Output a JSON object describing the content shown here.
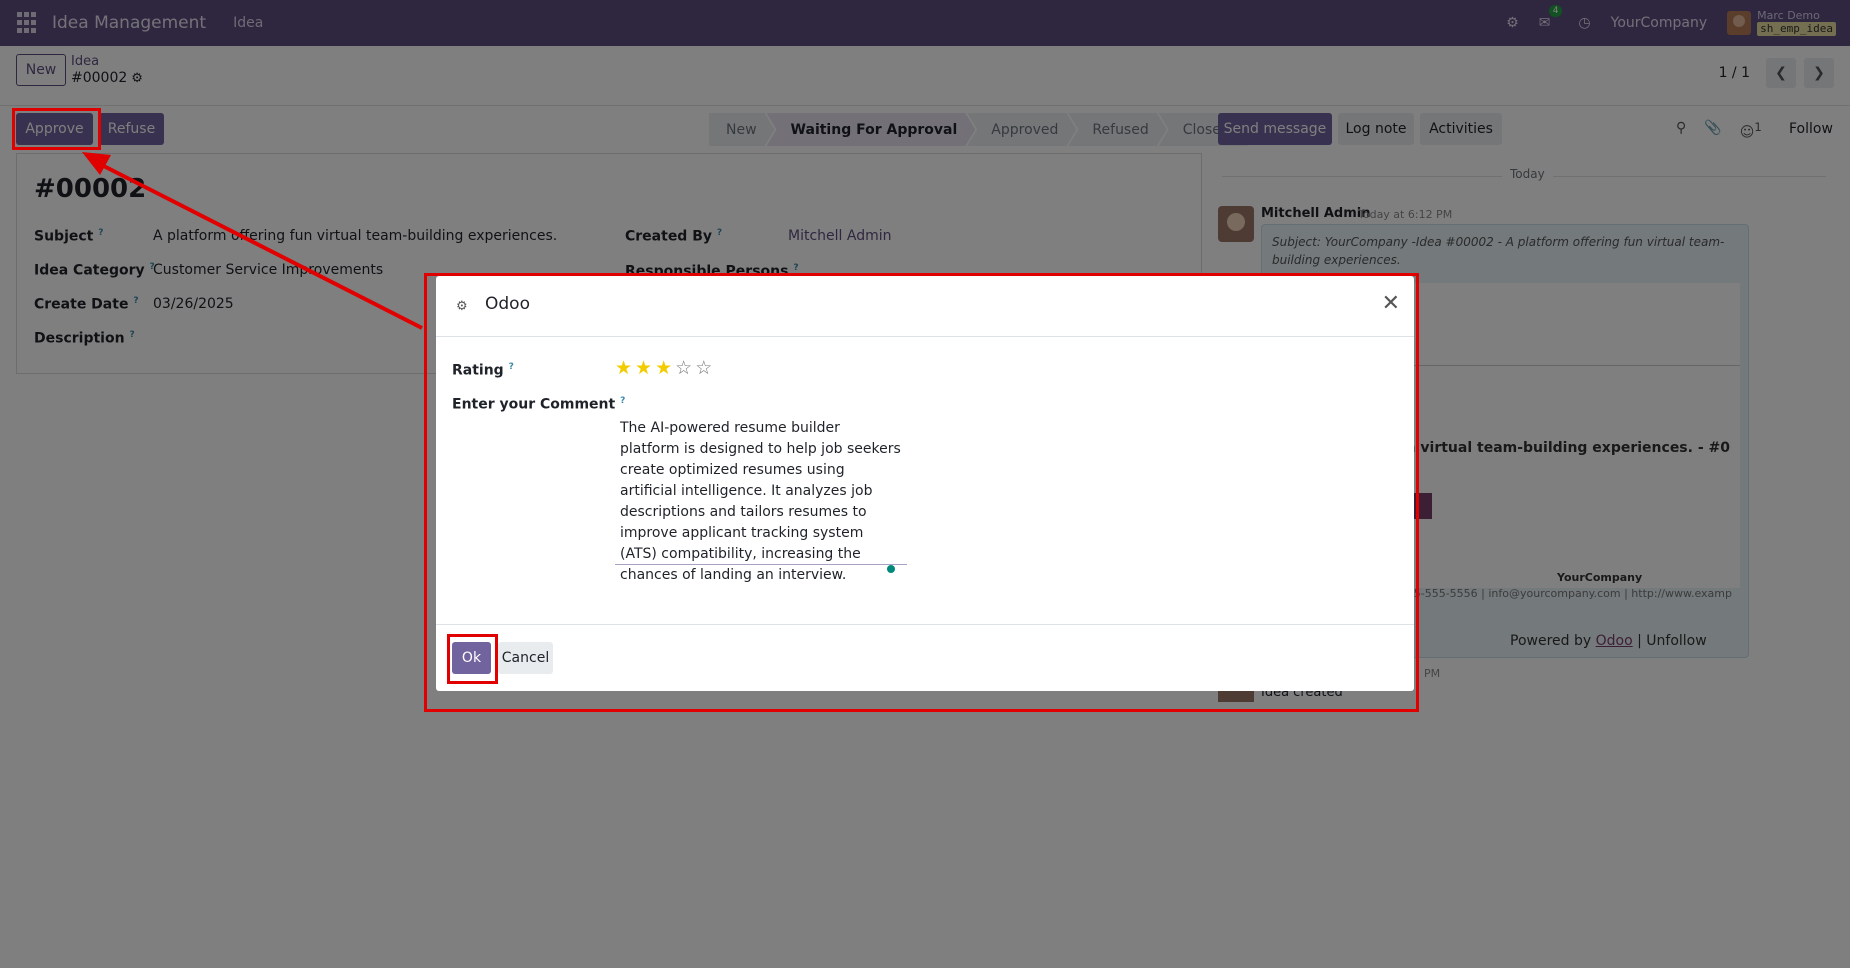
{
  "navbar": {
    "app_name": "Idea Management",
    "menu_item": "Idea",
    "chat_badge": "4",
    "company": "YourCompany",
    "user_name": "Marc Demo",
    "db_name": "sh_emp_idea"
  },
  "control": {
    "new_label": "New",
    "breadcrumb_parent": "Idea",
    "breadcrumb_current": "#00002",
    "pager_value": "1 / 1"
  },
  "actions": {
    "approve_label": "Approve",
    "refuse_label": "Refuse"
  },
  "statusbar": {
    "stages": [
      "New",
      "Waiting For Approval",
      "Approved",
      "Refused",
      "Closed"
    ],
    "active": "Waiting For Approval"
  },
  "form": {
    "record_name": "#00002",
    "subject_label": "Subject",
    "subject_value": "A platform offering fun virtual team-building experiences.",
    "category_label": "Idea Category",
    "category_value": "Customer Service Improvements",
    "create_date_label": "Create Date",
    "create_date_value": "03/26/2025",
    "description_label": "Description",
    "created_by_label": "Created By",
    "created_by_value": "Mitchell Admin",
    "responsible_label": "Responsible Persons",
    "tooltip_mark": "?"
  },
  "chatter": {
    "send_message_label": "Send message",
    "log_note_label": "Log note",
    "activities_label": "Activities",
    "followers_count": "1",
    "follow_label": "Follow",
    "today_label": "Today",
    "author": "Mitchell Admin",
    "time": "Today at 6:12 PM",
    "subject_line": "Subject: YourCompany -Idea #00002 - A platform offering fun virtual team-building experiences.",
    "body_bold": "ering fun virtual team-building experiences. - #0",
    "company_footer": "YourCompany",
    "contact_footer": "+1 555-555-5556 | info@yourcompany.com | http://www.examp",
    "powered_by": "Powered by",
    "odoo_link": "Odoo",
    "unfollow": "| Unfollow",
    "time2": "PM",
    "created_label": "Idea created"
  },
  "dialog": {
    "title": "Odoo",
    "rating_label": "Rating",
    "rating_value": 3,
    "rating_max": 5,
    "comment_label": "Enter your Comment",
    "comment_value": "The AI-powered resume builder platform is designed to help job seekers create optimized resumes using artificial intelligence. It analyzes job descriptions and tailors resumes to improve applicant tracking system (ATS) compatibility, increasing the chances of landing an interview.",
    "ok_label": "Ok",
    "cancel_label": "Cancel"
  },
  "icons": [
    "apps-icon",
    "bug-icon",
    "chat-icon",
    "clock-icon",
    "gear-icon",
    "chevron-left-icon",
    "chevron-right-icon",
    "search-icon",
    "paperclip-icon",
    "user-icon",
    "close-icon",
    "star-icon"
  ],
  "colors": {
    "brand": "#5e4e80",
    "primary_button": "#71639e",
    "annotation_red": "#e00000",
    "star": "#f3cc00"
  }
}
